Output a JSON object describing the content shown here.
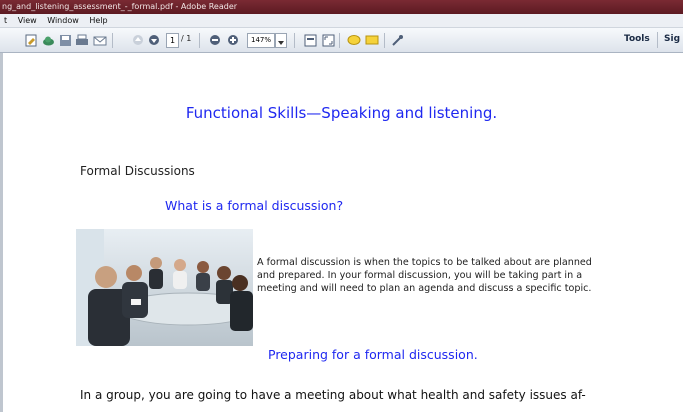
{
  "window": {
    "title": "ng_and_listening_assessment_-_formal.pdf - Adobe Reader"
  },
  "menu": {
    "items": [
      {
        "label": "t"
      },
      {
        "label": "View"
      },
      {
        "label": "Window"
      },
      {
        "label": "Help"
      }
    ]
  },
  "toolbar": {
    "current_page": "1",
    "page_total": "/ 1",
    "zoom": "147%",
    "tools_label": "Tools",
    "sign_label": "Sig"
  },
  "document": {
    "title": "Functional Skills—Speaking and listening.",
    "heading_formal": "Formal Discussions",
    "heading_what": "What is a formal discussion?",
    "paragraph_lines": [
      "A formal discussion is when the topics to be talked about are planned",
      "and prepared.  In your formal discussion, you will be taking part in a",
      "meeting and will need to plan an agenda and discuss a specific topic."
    ],
    "heading_prepare": "Preparing for a formal discussion.",
    "group_text": "In a group, you are going to have a meeting about what health and safety issues af-"
  },
  "colors": {
    "heading_blue": "#1f28f0",
    "titlebar": "#5c1a22"
  },
  "icons": [
    "create-pdf-icon",
    "cloud-icon",
    "save-icon",
    "print-icon",
    "email-icon",
    "prev-page-icon",
    "next-page-icon",
    "zoom-out-icon",
    "zoom-in-icon",
    "fit-page-icon",
    "full-screen-icon",
    "comment-icon",
    "highlight-icon",
    "sign-tool-icon"
  ]
}
